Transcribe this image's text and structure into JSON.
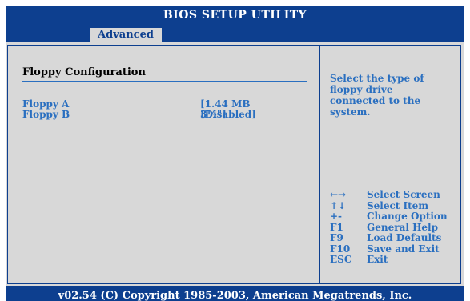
{
  "title": "BIOS SETUP UTILITY",
  "tabs": [
    {
      "label": "Advanced",
      "active": true
    }
  ],
  "section": {
    "title": "Floppy Configuration"
  },
  "settings": [
    {
      "label": "Floppy A",
      "value": "[1.44 MB 3½\"]"
    },
    {
      "label": "Floppy B",
      "value": "[Disabled]"
    }
  ],
  "help": {
    "text": "Select the type of floppy drive connected to the system."
  },
  "keys": [
    {
      "key": "←→",
      "desc": "Select Screen"
    },
    {
      "key": "↑↓",
      "desc": "Select Item"
    },
    {
      "key": "+-",
      "desc": "Change Option"
    },
    {
      "key": "F1",
      "desc": "General Help"
    },
    {
      "key": "F9",
      "desc": "Load Defaults"
    },
    {
      "key": "F10",
      "desc": "Save and Exit"
    },
    {
      "key": "ESC",
      "desc": "Exit"
    }
  ],
  "footer": "v02.54 (C) Copyright 1985-2003, American Megatrends, Inc.",
  "colors": {
    "frame_blue": "#0d3f8f",
    "text_blue": "#2a6fc0",
    "panel_gray": "#d8d8d8"
  }
}
